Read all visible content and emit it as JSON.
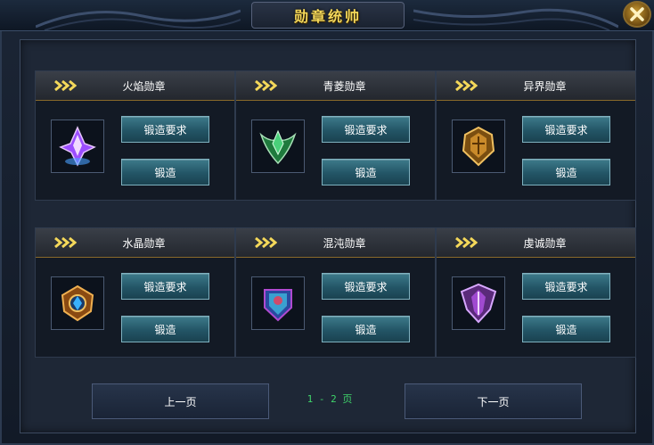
{
  "window": {
    "title": "勋章统帅"
  },
  "medals": [
    {
      "name": "火焰勋章",
      "requirement_label": "锻造要求",
      "forge_label": "锻造",
      "icon": "flame-crystal-medal-icon"
    },
    {
      "name": "青菱勋章",
      "requirement_label": "锻造要求",
      "forge_label": "锻造",
      "icon": "green-diamond-medal-icon"
    },
    {
      "name": "异界勋章",
      "requirement_label": "锻造要求",
      "forge_label": "锻造",
      "icon": "otherworld-medal-icon"
    },
    {
      "name": "水晶勋章",
      "requirement_label": "锻造要求",
      "forge_label": "锻造",
      "icon": "crystal-medal-icon"
    },
    {
      "name": "混沌勋章",
      "requirement_label": "锻造要求",
      "forge_label": "锻造",
      "icon": "chaos-medal-icon"
    },
    {
      "name": "虔诚勋章",
      "requirement_label": "锻造要求",
      "forge_label": "锻造",
      "icon": "devotion-medal-icon"
    }
  ],
  "pagination": {
    "prev_label": "上一页",
    "next_label": "下一页",
    "indicator": "1 - 2 页"
  },
  "colors": {
    "title": "#f4d85a",
    "button": "#235566",
    "page_indicator": "#3fd36a",
    "accent_gold": "#8a6a2a"
  }
}
